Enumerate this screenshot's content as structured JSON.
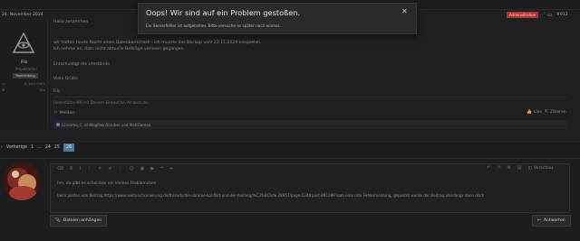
{
  "post": {
    "date": "24. November 2024",
    "staff_badge": "Administration",
    "post_number": "#912",
    "author": {
      "name": "Filz",
      "title": "Projektleiter",
      "role_badge": "Teamleitung",
      "joined": "8. Juni 2007",
      "post_count": "14k"
    },
    "body": [
      "Hallo zusammen",
      "wir hatten heute Nacht einen Datenbankcrash - ich musste das Backup vom 22.11.2024 einspielen.",
      "Ich nehme an, dass nicht aktuelle Beiträge verloren gegangen.",
      "Entschuldigt die Umstände",
      "Viele Grüße",
      "Filz"
    ],
    "signature": "Unterstütze WH mit Deinem Einkauf bei Amazon.de.",
    "report_label": "Melden",
    "like_label": "Like",
    "quote_label": "Zitieren",
    "reactions_text": "Giacomo_C, lchMagMeinStauber und MattGamed"
  },
  "pagination": {
    "prev_label": "Vorherige",
    "pages": [
      "1",
      "…",
      "24",
      "25",
      "26"
    ],
    "active": "26"
  },
  "editor": {
    "preview_label": "Vorschau",
    "text_line1": "hm, da gibt es scheinbar ein kleines Problemchen",
    "text_line2": "beim posten von Beitrag https://www.weltenchronierung.de/threads/die-ukraine-konflikt-und-der-heimeg/%C3%BChde.28957/page-134#post-891089 kam eine rote Fehlermeldung, gepostet wurde der Beitrag allerdings dann doch",
    "attach_label": "Dateien anhängen",
    "reply_label": "Antworten"
  },
  "toast": {
    "title": "Oops! Wir sind auf ein Problem gestoßen.",
    "message": "Ein Serverfehler ist aufgetreten. Bitte versuche es später noch einmal.",
    "close_icon": "close-icon"
  },
  "colors": {
    "background": "#1c1c1e",
    "accent": "#4d7a99",
    "staff_badge": "#b8322d",
    "link": "#5f8fb8"
  }
}
